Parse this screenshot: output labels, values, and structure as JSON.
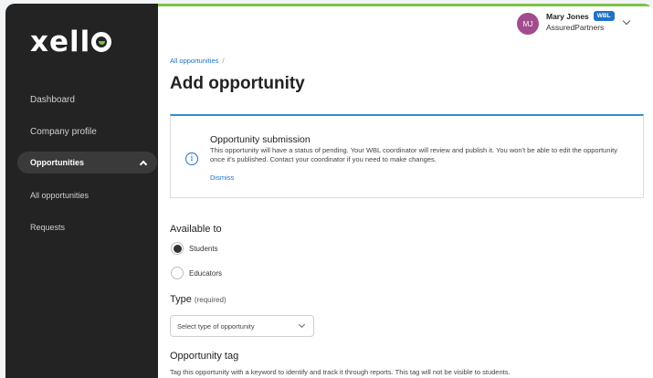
{
  "brand": {
    "logo_text_prefix": "xell",
    "accent_color": "#7ac143"
  },
  "sidebar": {
    "items": [
      {
        "label": "Dashboard"
      },
      {
        "label": "Company profile"
      },
      {
        "label": "Opportunities",
        "active": true,
        "expanded": true
      },
      {
        "label": "All opportunities"
      },
      {
        "label": "Requests"
      }
    ]
  },
  "user": {
    "initials": "MJ",
    "name": "Mary Jones",
    "badge": "WBL",
    "company": "AssuredPartners"
  },
  "breadcrumb": {
    "link": "All opportunities",
    "separator": "/"
  },
  "page": {
    "title": "Add opportunity"
  },
  "notice": {
    "title": "Opportunity submission",
    "body": "This opportunity will have a status of pending. Your WBL coordinator will review and publish it. You won't be able to edit the opportunity once it's published. Contact your coordinator if you need to make changes.",
    "dismiss": "Dismiss",
    "icon": "info-icon"
  },
  "form": {
    "available_to": {
      "label": "Available to",
      "options": [
        {
          "label": "Students",
          "checked": true
        },
        {
          "label": "Educators",
          "checked": false
        }
      ]
    },
    "type": {
      "label": "Type",
      "required_hint": "(required)",
      "placeholder": "Select type of opportunity"
    },
    "tag": {
      "label": "Opportunity tag",
      "help": "Tag this opportunity with a keyword to identify and track it through reports. This tag will not be visible to students."
    }
  }
}
